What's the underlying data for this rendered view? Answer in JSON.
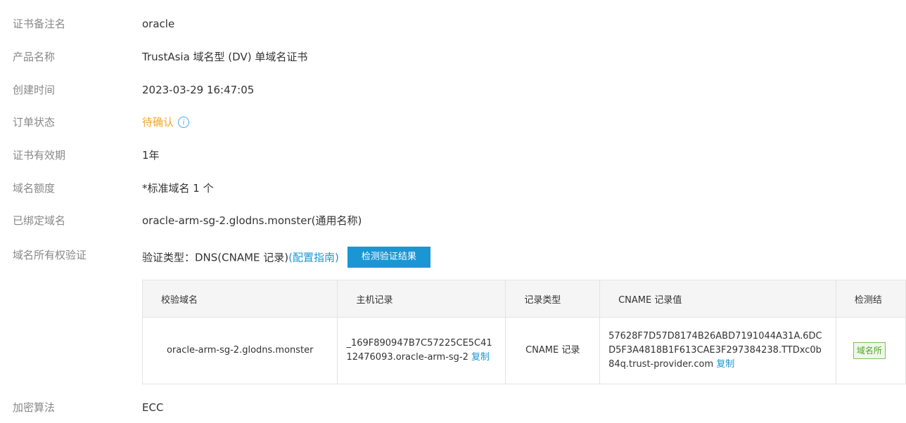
{
  "fields": {
    "cert_note": {
      "label": "证书备注名",
      "value": "oracle"
    },
    "product_name": {
      "label": "产品名称",
      "value": "TrustAsia 域名型 (DV) 单域名证书"
    },
    "created_time": {
      "label": "创建时间",
      "value": "2023-03-29 16:47:05"
    },
    "order_status": {
      "label": "订单状态",
      "value": "待确认"
    },
    "validity": {
      "label": "证书有效期",
      "value": "1年"
    },
    "domain_quota": {
      "label": "域名额度",
      "value": "*标准域名 1 个"
    },
    "bound_domain": {
      "label": "已绑定域名",
      "value": "oracle-arm-sg-2.glodns.monster(通用名称)"
    },
    "ownership": {
      "label": "域名所有权验证",
      "type_text": "验证类型：DNS(CNAME 记录)",
      "guide_link": "(配置指南)",
      "check_button": "检测验证结果"
    },
    "encryption": {
      "label": "加密算法",
      "value": "ECC"
    }
  },
  "dns_table": {
    "headers": [
      "校验域名",
      "主机记录",
      "记录类型",
      "CNAME 记录值",
      "检测结"
    ],
    "row": {
      "domain": "oracle-arm-sg-2.glodns.monster",
      "host_record": "_169F890947B7C57225CE5C4112476093.oracle-arm-sg-2",
      "record_type": "CNAME 记录",
      "cname_value": "57628F7D57D8174B26ABD7191044A31A.6DCD5F3A4818B1F613CAE3F297384238.TTDxc0b84q.trust-provider.com",
      "copy_label": "复制",
      "result_tag": "域名所"
    }
  },
  "colors": {
    "accent": "#1a96d4",
    "pending": "#f5a623",
    "success": "#52a52b"
  }
}
